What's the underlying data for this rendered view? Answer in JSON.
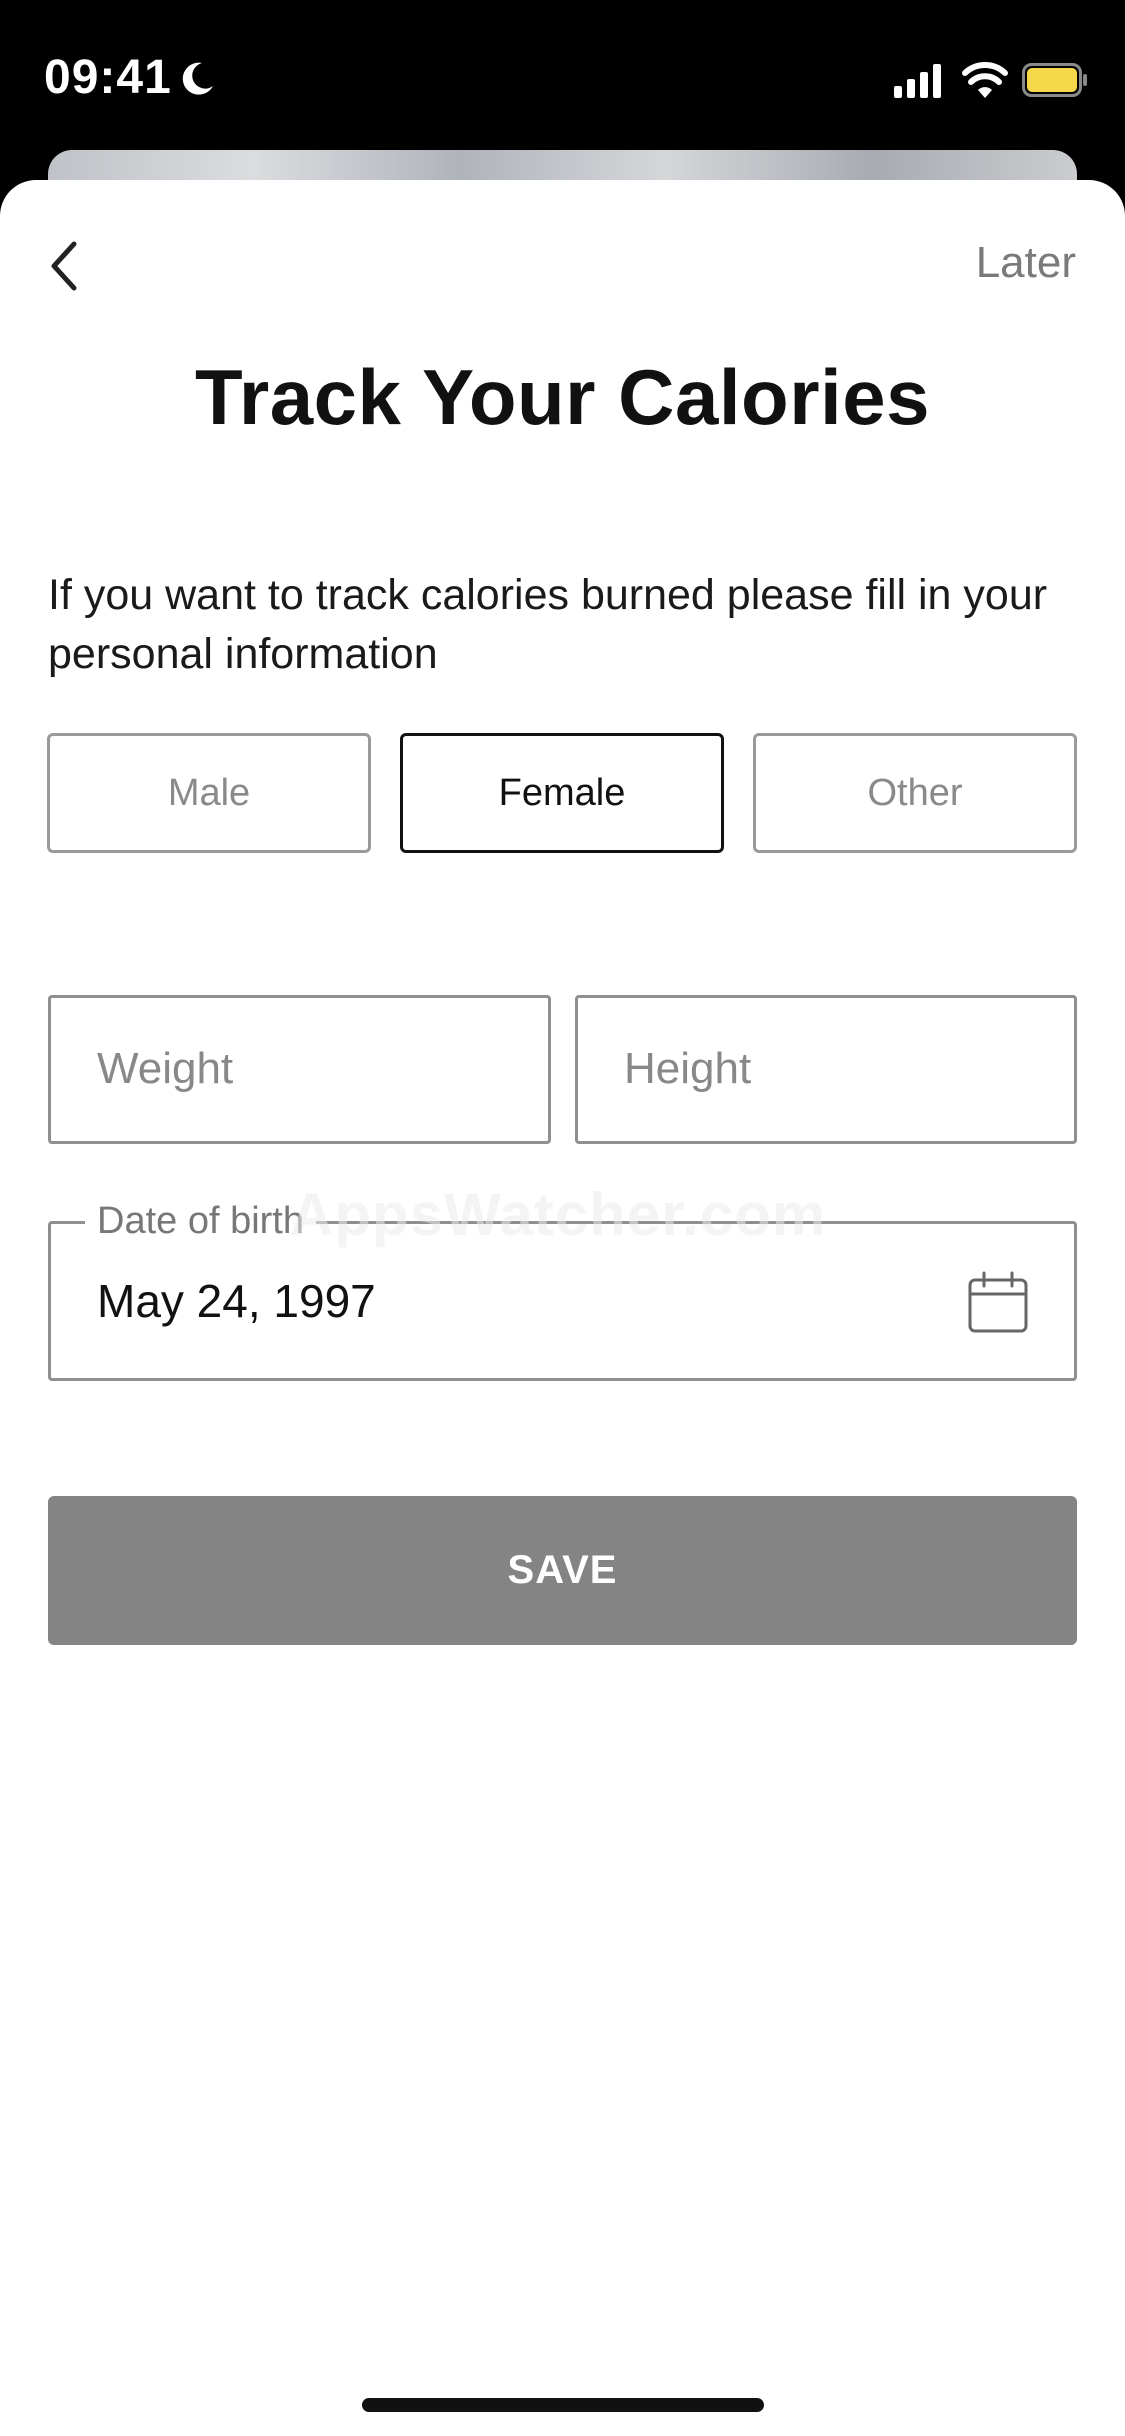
{
  "status_bar": {
    "time": "09:41",
    "icons": [
      "moon-icon",
      "signal-icon",
      "wifi-icon",
      "battery-icon"
    ],
    "battery_color": "#f5d94a"
  },
  "header": {
    "back_icon": "chevron-left-icon",
    "later_label": "Later"
  },
  "title": "Track Your Calories",
  "intro": "If you want to track calories burned please fill in your personal information",
  "gender": {
    "options": [
      "Male",
      "Female",
      "Other"
    ],
    "selected": "Female"
  },
  "fields": {
    "weight_placeholder": "Weight",
    "height_placeholder": "Height",
    "dob_label": "Date of birth",
    "dob_value": "May 24, 1997"
  },
  "save_label": "SAVE",
  "watermark": "AppsWatcher.com",
  "colors": {
    "save_button": "#848484",
    "selected_border": "#111111",
    "unselected_border": "#9a9a9a"
  }
}
